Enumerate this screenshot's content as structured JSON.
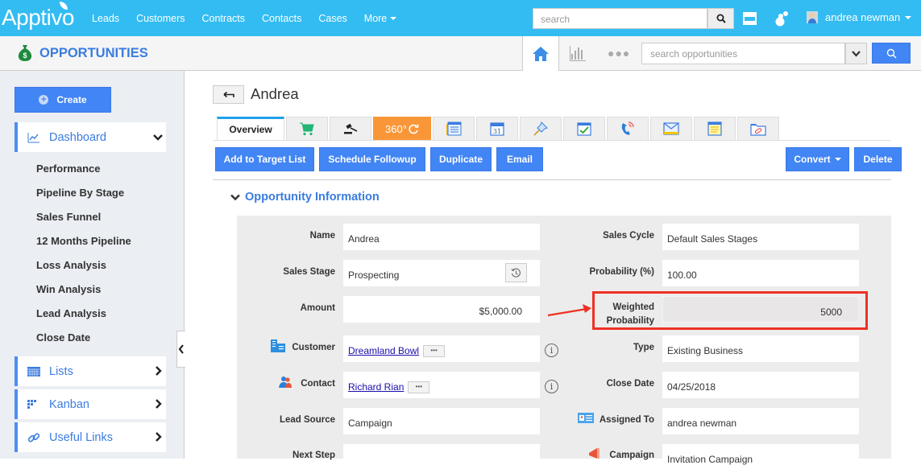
{
  "topbar": {
    "logo": "Apptivo",
    "nav": [
      "Leads",
      "Customers",
      "Contracts",
      "Contacts",
      "Cases"
    ],
    "more_label": "More",
    "search_placeholder": "search",
    "user_name": "andrea newman",
    "brand_color": "#33bcf2"
  },
  "app": {
    "title": "OPPORTUNITIES",
    "search_placeholder": "search opportunities"
  },
  "sidebar": {
    "create_label": "Create",
    "dashboard_label": "Dashboard",
    "dashboard_items": [
      "Performance",
      "Pipeline By Stage",
      "Sales Funnel",
      "12 Months Pipeline",
      "Loss Analysis",
      "Win Analysis",
      "Lead Analysis",
      "Close Date"
    ],
    "lists_label": "Lists",
    "kanban_label": "Kanban",
    "useful_links_label": "Useful Links"
  },
  "record": {
    "title": "Andrea",
    "tabs": {
      "overview": "Overview",
      "icon_tabs": [
        "cart-icon",
        "gavel-icon",
        "360-icon",
        "notes-form-icon",
        "calendar-icon",
        "pin-icon",
        "task-check-icon",
        "phone-icon",
        "email-icon",
        "sticky-note-icon",
        "attachment-folder-icon"
      ],
      "tab_360_label": "360°"
    },
    "actions": {
      "add_to_target_list": "Add to Target List",
      "schedule_followup": "Schedule Followup",
      "duplicate": "Duplicate",
      "email": "Email",
      "convert": "Convert",
      "delete": "Delete"
    }
  },
  "section": {
    "title": "Opportunity Information",
    "left_fields": [
      {
        "label": "Name",
        "value": "Andrea"
      },
      {
        "label": "Sales Stage",
        "value": "Prospecting"
      },
      {
        "label": "Amount",
        "value": "$5,000.00"
      },
      {
        "label": "Customer",
        "value": "Dreamland Bowl"
      },
      {
        "label": "Contact",
        "value": "Richard Rian"
      },
      {
        "label": "Lead Source",
        "value": "Campaign"
      },
      {
        "label": "Next Step",
        "value": ""
      }
    ],
    "right_fields": [
      {
        "label": "Sales Cycle",
        "value": "Default Sales Stages"
      },
      {
        "label": "Probability (%)",
        "value": "100.00"
      },
      {
        "label": "Weighted Probability",
        "label_line1": "Weighted",
        "label_line2": "Probability",
        "value": "5000"
      },
      {
        "label": "Type",
        "value": "Existing Business"
      },
      {
        "label": "Close Date",
        "value": "04/25/2018"
      },
      {
        "label": "Assigned To",
        "value": "andrea newman"
      },
      {
        "label": "Campaign",
        "value": "Invitation Campaign"
      }
    ],
    "annotation_color": "#ee3124"
  }
}
